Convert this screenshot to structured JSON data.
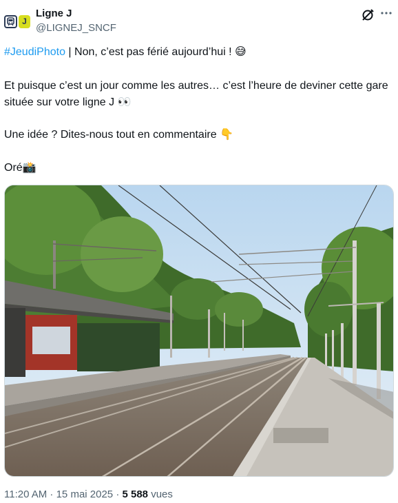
{
  "account": {
    "name": "Ligne J",
    "handle": "@LIGNEJ_SNCF",
    "avatar_letter": "J"
  },
  "icons": {
    "grok": "grok-icon",
    "more": "more-dots-icon"
  },
  "tweet": {
    "hashtag": "#JeudiPhoto",
    "line1_rest": " | Non, c’est pas férié aujourd’hui ! 😅",
    "line2": "Et puisque c’est un jour comme les autres… c’est l’heure de deviner cette gare située sur votre ligne J 👀",
    "line3": "Une idée ? Dites-nous tout en commentaire 👇",
    "line4": "Oré📸"
  },
  "photo": {
    "alt": "Photo of a railway station platform with overhead wires and trees"
  },
  "meta": {
    "time": "11:20 AM · 15 mai 2025 · ",
    "views_count": "5 588",
    "views_label": " vues"
  }
}
